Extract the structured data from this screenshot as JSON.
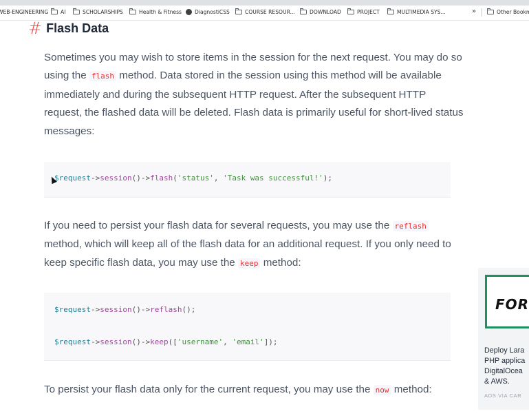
{
  "bookmarks": [
    {
      "label": "WEB-ENGINEERING",
      "icon": "none"
    },
    {
      "label": "AI",
      "icon": "folder-icon"
    },
    {
      "label": "SCHOLARSHIPS",
      "icon": "folder-icon"
    },
    {
      "label": "Health & Fitness",
      "icon": "folder-icon"
    },
    {
      "label": "DiagnostiCSS",
      "icon": "globe-icon"
    },
    {
      "label": "COURSE RESOUR...",
      "icon": "folder-icon"
    },
    {
      "label": "DOWNLOAD",
      "icon": "folder-icon"
    },
    {
      "label": "PROJECT",
      "icon": "folder-icon"
    },
    {
      "label": "MULTIMEDIA SYS...",
      "icon": "folder-icon"
    },
    {
      "label": "Other Bookmarks",
      "icon": "folder-icon"
    }
  ],
  "overflow_label": "»",
  "heading": {
    "hash": "#",
    "title": "Flash Data"
  },
  "p1": {
    "t1": "Sometimes you may wish to store items in the session for the next request. You may do so using the ",
    "code1": "flash",
    "t2": " method. Data stored in the session using this method will be available immediately and during the subsequent HTTP request. After the subsequent HTTP request, the flashed data will be deleted. Flash data is primarily useful for short-lived status messages:"
  },
  "code1": {
    "var": "$request",
    "arrow1": "->",
    "fn1": "session",
    "paren1": "()",
    "arrow2": "->",
    "fn2": "flash",
    "open": "(",
    "arg1": "'status'",
    "comma": ", ",
    "arg2": "'Task was successful!'",
    "close": ");"
  },
  "p2": {
    "t1": "If you need to persist your flash data for several requests, you may use the ",
    "code1": "reflash",
    "t2": " method, which will keep all of the flash data for an additional request. If you only need to keep specific flash data, you may use the ",
    "code2": "keep",
    "t3": " method:"
  },
  "code2": {
    "line1": {
      "var": "$request",
      "a1": "->",
      "fn1": "session",
      "p1": "()",
      "a2": "->",
      "fn2": "reflash",
      "end": "();"
    },
    "line2": {
      "var": "$request",
      "a1": "->",
      "fn1": "session",
      "p1": "()",
      "a2": "->",
      "fn2": "keep",
      "open": "([",
      "s1": "'username'",
      "comma": ", ",
      "s2": "'email'",
      "end": "]);"
    }
  },
  "p3": {
    "t1": "To persist your flash data only for the current request, you may use the ",
    "code1": "now",
    "t2": " method:"
  },
  "ad": {
    "logo_text": "FOR",
    "body": "Deploy Lara\nPHP applica\nDigitalOcea\n& AWS.",
    "via": "ADS VIA CAR"
  }
}
